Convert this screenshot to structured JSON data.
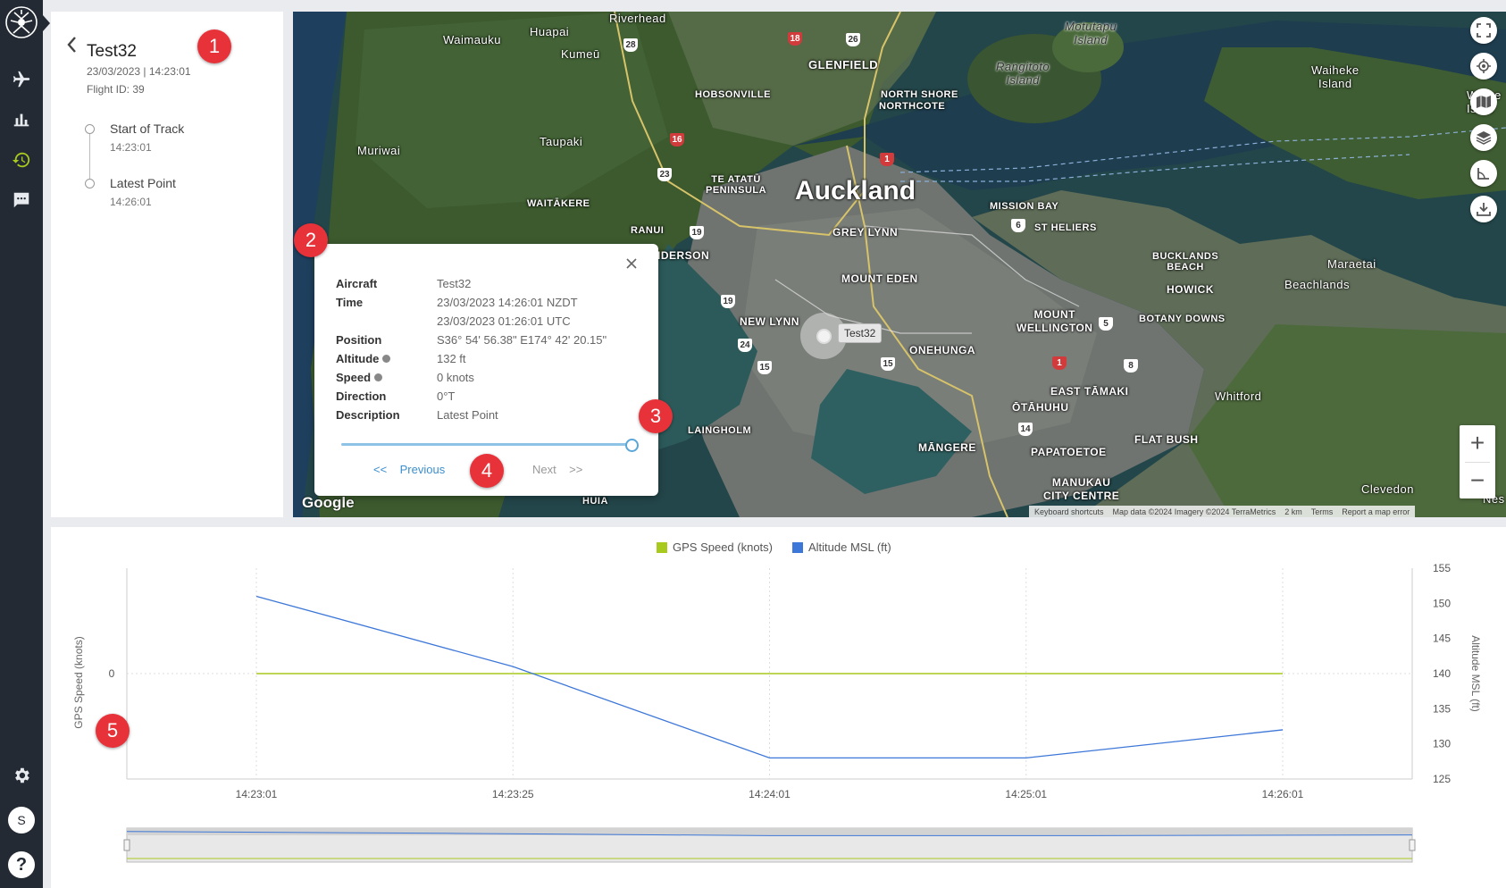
{
  "colors": {
    "rail": "#232a33",
    "accent": "#a8c91e",
    "speed_series": "#a8c91e",
    "altitude_series": "#3d77d8",
    "step_marker": "#e8323a",
    "link": "#3c8fcf"
  },
  "rail": {
    "icons": [
      "logo-icon",
      "aircraft-icon",
      "bar-chart-icon",
      "history-icon",
      "chat-icon",
      "gear-icon"
    ],
    "avatar_initial": "S",
    "help_label": "?"
  },
  "track": {
    "title": "Test32",
    "datetime": "23/03/2023 | 14:23:01",
    "flight_id": "Flight ID: 39",
    "points": [
      {
        "label": "Start of Track",
        "time": "14:23:01"
      },
      {
        "label": "Latest Point",
        "time": "14:26:01"
      }
    ]
  },
  "map": {
    "labels": {
      "auckland": "Auckland",
      "riverhead": "Riverhead",
      "waimauku": "Waimauku",
      "huapai": "Huapai",
      "kumeu": "Kumeū",
      "glenfield": "GLENFIELD",
      "hobsonville": "HOBSONVILLE",
      "north_shore": "NORTH SHORE",
      "northcote": "NORTHCOTE",
      "motutapu": "Motutapu\nIsland",
      "rangitoto": "Rangitoto\nIsland",
      "waiheke": "Waiheke\nIsland",
      "waiheke2": "Waihe\nIslan",
      "muriwai": "Muriwai",
      "taupaki": "Taupaki",
      "te_atatu": "TE ATATŪ\nPENINSULA",
      "waitakere": "WAITĀKERE",
      "ranui": "RANUI",
      "henderson": "HENDERSON",
      "grey_lynn": "GREY LYNN",
      "mission_bay": "MISSION BAY",
      "st_heliers": "ST HELIERS",
      "mount_eden": "MOUNT EDEN",
      "new_lynn": "NEW LYNN",
      "onehunga": "ONEHUNGA",
      "mount_wellington": "MOUNT\nWELLINGTON",
      "bucklands": "BUCKLANDS\nBEACH",
      "howick": "HOWICK",
      "botany": "BOTANY DOWNS",
      "maraetai": "Maraetai",
      "beachlands": "Beachlands",
      "east_tamaki": "EAST TĀMAKI",
      "whitford": "Whitford",
      "otahuhu": "ŌTĀHUHU",
      "mangere": "MĀNGERE",
      "papatoetoe": "PAPATOETOE",
      "flat_bush": "FLAT BUSH",
      "manukau": "MANUKAU\nCITY CENTRE",
      "laingholm": "LAINGHOLM",
      "huia": "HUIA",
      "clevedon": "Clevedon",
      "nes": "Nes"
    },
    "google": "Google",
    "attribution": [
      "Keyboard shortcuts",
      "Map data ©2024 Imagery ©2024 TerraMetrics",
      "2 km",
      "Terms",
      "Report a map error"
    ],
    "aircraft_label": "Test32",
    "controls": [
      "fullscreen-icon",
      "locate-icon",
      "map-type-icon",
      "layers-icon",
      "measure-icon",
      "download-icon"
    ],
    "zoom_in": "+",
    "zoom_out": "−"
  },
  "popup": {
    "rows": [
      {
        "key": "Aircraft",
        "value": "Test32"
      },
      {
        "key": "Time",
        "value": "23/03/2023 14:26:01 NZDT",
        "value2": "23/03/2023 01:26:01 UTC"
      },
      {
        "key": "Position",
        "value": "S36° 54' 56.38\" E174° 42' 20.15\""
      },
      {
        "key": "Altitude",
        "value": "132 ft",
        "info": true
      },
      {
        "key": "Speed",
        "value": "0 knots",
        "info": true
      },
      {
        "key": "Direction",
        "value": "0°T"
      },
      {
        "key": "Description",
        "value": "Latest Point"
      }
    ],
    "slider_position": 1.0,
    "prev_label": "<<    Previous",
    "next_label": "Next    >>"
  },
  "steps": [
    "1",
    "2",
    "3",
    "4",
    "5"
  ],
  "chart_data": {
    "type": "line",
    "categories": [
      "14:23:01",
      "14:23:25",
      "14:24:01",
      "14:25:01",
      "14:26:01"
    ],
    "series": [
      {
        "name": "GPS Speed (knots)",
        "axis": "left",
        "values": [
          0,
          0,
          0,
          0,
          0
        ]
      },
      {
        "name": "Altitude MSL (ft)",
        "axis": "right",
        "values": [
          151,
          141,
          128,
          128,
          132
        ]
      }
    ],
    "ylabel_left": "GPS Speed (knots)",
    "ylabel_right": "Altitude MSL (ft)",
    "left_ticks": [
      "0"
    ],
    "right_ylim": [
      125,
      155
    ],
    "right_ticks": [
      "155",
      "150",
      "145",
      "140",
      "135",
      "130",
      "125"
    ],
    "legend_position": "top-center",
    "grid": true
  }
}
